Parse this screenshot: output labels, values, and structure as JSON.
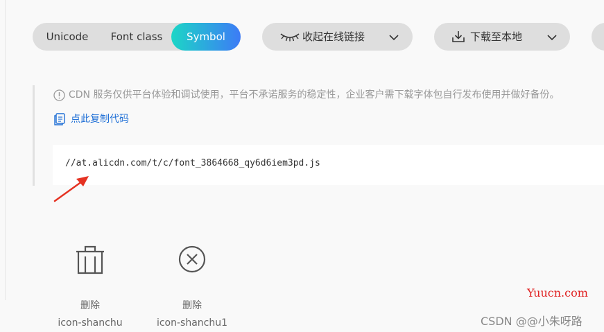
{
  "toolbar": {
    "mode_tabs": [
      {
        "label": "Unicode",
        "active": false
      },
      {
        "label": "Font class",
        "active": false
      },
      {
        "label": "Symbol",
        "active": true
      }
    ],
    "toggle_link_label": "收起在线链接",
    "download_label": "下载至本地",
    "active_gradient": [
      "#1cd6c6",
      "#3d7bf6"
    ],
    "icons": {
      "toggle": "eye-closed-icon",
      "download": "download-icon",
      "chevron": "chevron-down-icon"
    }
  },
  "panel": {
    "notice": "CDN 服务仅供平台体验和调试使用，平台不承诺服务的稳定性，企业客户需下载字体包自行发布使用并做好备份。",
    "copy_label": "点此复制代码",
    "code_url": "//at.alicdn.com/t/c/font_3864668_qy6d6iem3pd.js",
    "link_color": "#1f6fd6"
  },
  "icons": [
    {
      "name": "删除",
      "code": "icon-shanchu",
      "glyph": "trash-icon"
    },
    {
      "name": "删除",
      "code": "icon-shanchu1",
      "glyph": "close-circle-icon"
    }
  ],
  "watermarks": {
    "site": "Yuucn.com",
    "csdn": "CSDN @@小朱呀路"
  }
}
